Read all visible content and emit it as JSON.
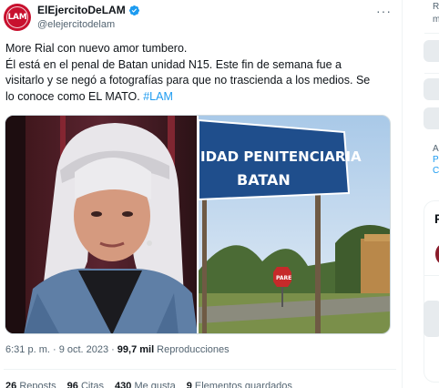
{
  "tweet": {
    "author": {
      "display_name": "ElEjercitoDeLAM",
      "handle": "@elejercitodelam",
      "avatar_text": "LAM",
      "verified": true
    },
    "more_label": "···",
    "text_lines": [
      "More Rial con nuevo amor tumbero.",
      "Él está en el penal de Batan unidad N15. Este fin de semana fue a",
      "visitarlo y se negó a fotografías para que no trascienda a los medios.  Se",
      "lo conoce como EL MATO."
    ],
    "hashtag": "#LAM",
    "media": {
      "left_photo": "photo-woman",
      "right_photo": {
        "sign_line1": "IDAD PENITENCIARIA",
        "sign_line2": "BATAN",
        "stop_sign": "PARE"
      }
    },
    "timestamp": "6:31 p. m. · 9 oct. 2023",
    "separator": "·",
    "views_count": "99,7 mil",
    "views_label": "Reproducciones",
    "stats": [
      {
        "count": "26",
        "label": "Reposts"
      },
      {
        "count": "96",
        "label": "Citas"
      },
      {
        "count": "430",
        "label": "Me gusta"
      },
      {
        "count": "9",
        "label": "Elementos guardados"
      }
    ]
  },
  "sidebar": {
    "top_text": "Re",
    "top_text2": "m",
    "mid_text": "Al",
    "link1": "Po",
    "link2": "Co",
    "section_title": "P"
  },
  "colors": {
    "accent": "#1d9bf0",
    "avatar_red": "#c8102e",
    "sign_blue": "#1f4e8c"
  }
}
